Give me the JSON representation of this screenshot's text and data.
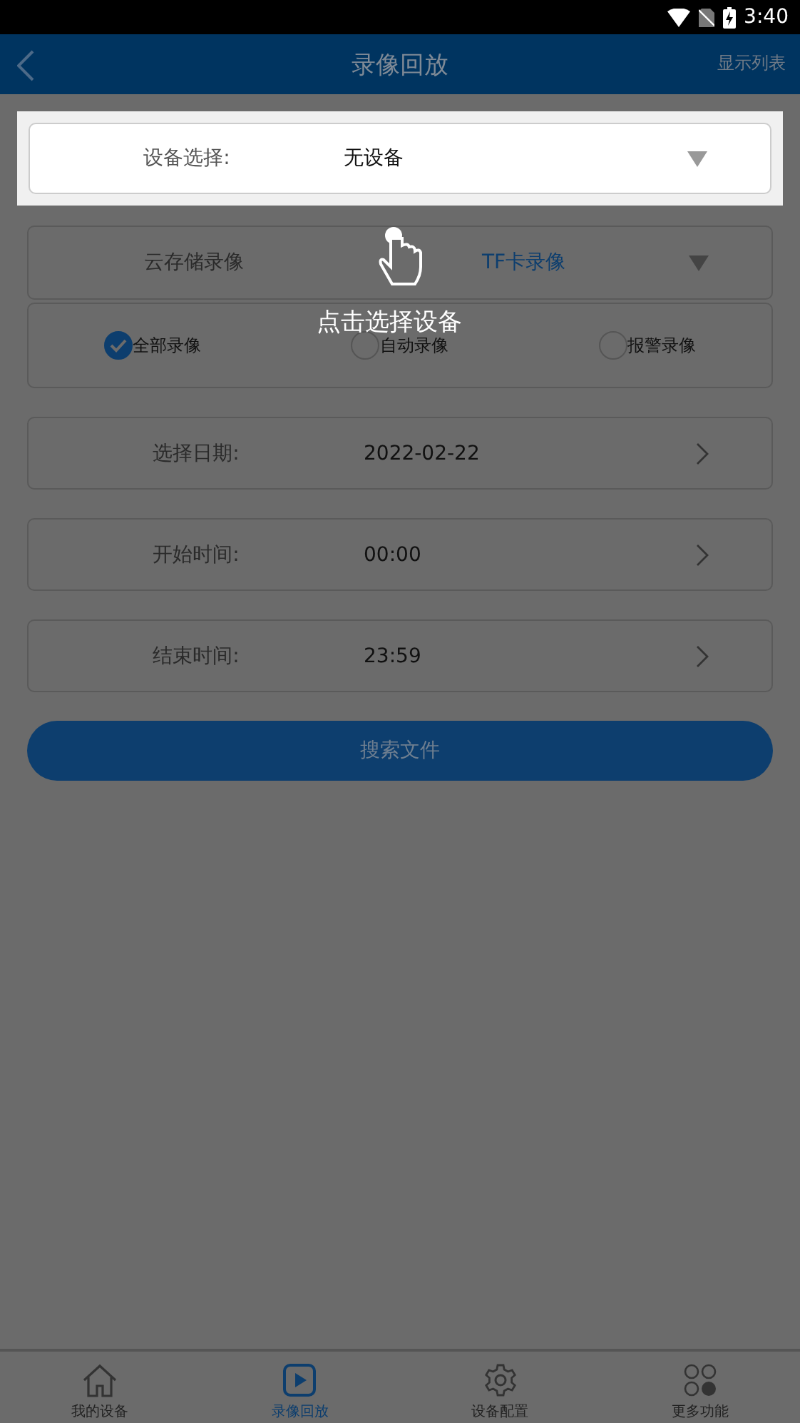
{
  "status_bar": {
    "time": "3:40"
  },
  "header": {
    "title": "录像回放",
    "action": "显示列表"
  },
  "device_select": {
    "label": "设备选择:",
    "value": "无设备"
  },
  "storage_tabs": [
    {
      "label": "云存储录像",
      "selected": false
    },
    {
      "label": "TF卡录像",
      "selected": true
    }
  ],
  "record_types": [
    {
      "label": "全部录像",
      "selected": true
    },
    {
      "label": "自动录像",
      "selected": false
    },
    {
      "label": "报警录像",
      "selected": false
    }
  ],
  "fields": [
    {
      "label": "选择日期:",
      "value": "2022-02-22"
    },
    {
      "label": "开始时间:",
      "value": "00:00"
    },
    {
      "label": "结束时间:",
      "value": "23:59"
    }
  ],
  "search_button": "搜索文件",
  "guide_tip": "点击选择设备",
  "tab_bar": [
    {
      "label": "我的设备",
      "kind": "home",
      "selected": false
    },
    {
      "label": "录像回放",
      "kind": "play",
      "selected": true
    },
    {
      "label": "设备配置",
      "kind": "gear",
      "selected": false
    },
    {
      "label": "更多功能",
      "kind": "more",
      "selected": false
    }
  ]
}
